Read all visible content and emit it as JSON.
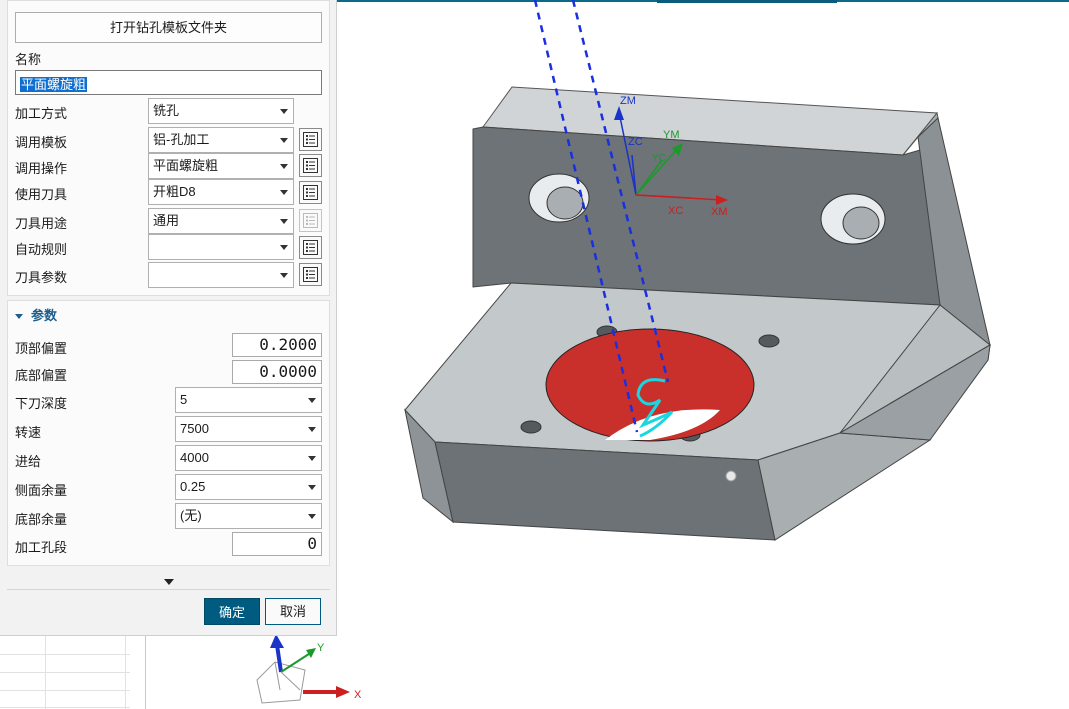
{
  "dialog": {
    "open_folder_button": "打开钻孔模板文件夹",
    "name_label": "名称",
    "name_value": "平面螺旋粗",
    "rows": [
      {
        "label": "加工方式",
        "value": "铣孔",
        "has_list_button": false
      },
      {
        "label": "调用模板",
        "value": "铝-孔加工",
        "has_list_button": true
      },
      {
        "label": "调用操作",
        "value": "平面螺旋粗",
        "has_list_button": true
      },
      {
        "label": "使用刀具",
        "value": "开粗D8",
        "has_list_button": true
      },
      {
        "label": "刀具用途",
        "value": "通用",
        "has_list_button": true,
        "list_button_disabled": true
      },
      {
        "label": "自动规则",
        "value": "",
        "has_list_button": true
      },
      {
        "label": "刀具参数",
        "value": "",
        "has_list_button": true
      }
    ],
    "params_header": "参数",
    "params": {
      "top_offset_label": "顶部偏置",
      "top_offset_value": "0.2000",
      "bottom_offset_label": "底部偏置",
      "bottom_offset_value": "0.0000",
      "depth_label": "下刀深度",
      "depth_value": "5",
      "speed_label": "转速",
      "speed_value": "7500",
      "feed_label": "进给",
      "feed_value": "4000",
      "side_stock_label": "侧面余量",
      "side_stock_value": "0.25",
      "floor_stock_label": "底部余量",
      "floor_stock_value": "(无)",
      "hole_segment_label": "加工孔段",
      "hole_segment_value": "0"
    },
    "ok_button": "确定",
    "cancel_button": "取消"
  },
  "viewport": {
    "wcs_labels": {
      "zm": "ZM",
      "zc": "ZC",
      "ym": "YM",
      "yc": "YC",
      "xc": "XC",
      "xm": "XM"
    },
    "triad_labels": {
      "y": "Y",
      "x": "X"
    },
    "colors": {
      "part_face_top": "#c2c7c9",
      "part_face_dark": "#6f7579",
      "hole_red": "#c9302c",
      "toolpath_cyan": "#19d6e0",
      "tool_axis_blue": "#1a2fe0",
      "accent": "#005b80"
    }
  }
}
